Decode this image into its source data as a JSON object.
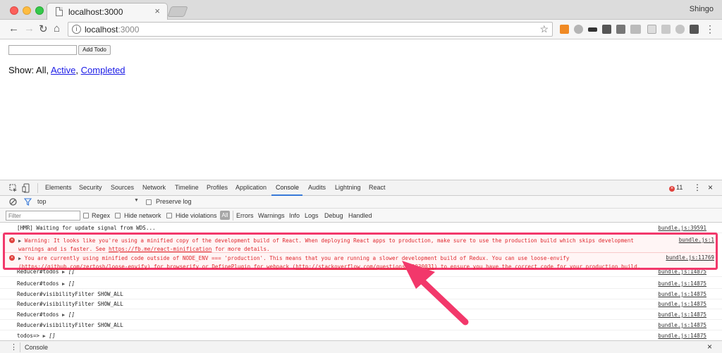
{
  "window": {
    "tab_title": "localhost:3000",
    "profile": "Shingo"
  },
  "address_bar": {
    "host": "localhost",
    "port": ":3000"
  },
  "page": {
    "add_button": "Add Todo",
    "show_label": "Show: All,",
    "filter_active": "Active",
    "separator": ",",
    "filter_completed": "Completed"
  },
  "devtools": {
    "tabs": [
      "Elements",
      "Security",
      "Sources",
      "Network",
      "Timeline",
      "Profiles",
      "Application",
      "Console",
      "Audits",
      "Lightning",
      "React"
    ],
    "active_tab": "Console",
    "error_count": "11",
    "context": "top",
    "preserve_log": "Preserve log",
    "filter_placeholder": "Filter",
    "regex": "Regex",
    "hide_network": "Hide network",
    "hide_violations": "Hide violations",
    "all": "All",
    "levels": [
      "Errors",
      "Warnings",
      "Info",
      "Logs",
      "Debug",
      "Handled"
    ],
    "drawer_tab": "Console"
  },
  "console": {
    "hidden_first": {
      "msg": "[HMR] Waiting for update signal from WDS...",
      "src": "bundle.js:39591"
    },
    "errors": [
      {
        "text1": "Warning: It looks like you're using a minified copy of the development build of React. When deploying React apps to production, make sure to use the production build which skips development warnings and is faster. See ",
        "link": "https://fb.me/react-minification",
        "text2": " for more details.",
        "src": "bundle.js:1"
      },
      {
        "text1": "You are currently using minified code outside of NODE_ENV === 'production'. This means that you are running a slower development build of Redux. You can use loose-envify (",
        "link": "https://github.com/zertosh/loose-envify",
        "text2": ") for browserify or DefinePlugin for webpack (",
        "link2": "http://stackoverflow.com/questions/30030031",
        "text3": ") to ensure you have the correct code for your production build.",
        "src": "bundle.js:11769"
      }
    ],
    "rows": [
      {
        "msg": "Reducer#todos",
        "arr": "[]",
        "src": "bundle.js:14875"
      },
      {
        "msg": "Reducer#todos",
        "arr": "[]",
        "src": "bundle.js:14875"
      },
      {
        "msg": "Reducer#visibilityFilter SHOW_ALL",
        "arr": "",
        "src": "bundle.js:14875"
      },
      {
        "msg": "Reducer#visibilityFilter SHOW_ALL",
        "arr": "",
        "src": "bundle.js:14875"
      },
      {
        "msg": "Reducer#todos",
        "arr": "[]",
        "src": "bundle.js:14875"
      },
      {
        "msg": "Reducer#visibilityFilter SHOW_ALL",
        "arr": "",
        "src": "bundle.js:14875"
      },
      {
        "msg": "todos=>",
        "arr": "[]",
        "src": "bundle.js:14875"
      }
    ]
  },
  "colors": {
    "highlight": "#f2386b",
    "error_text": "#e0282e",
    "link": "#1a1ae6",
    "devtools_accent": "#3879d9"
  },
  "icons": {
    "back": "←",
    "forward": "→",
    "reload": "↻",
    "home": "⌂",
    "star": "☆",
    "close": "×",
    "menu": "⋮"
  }
}
